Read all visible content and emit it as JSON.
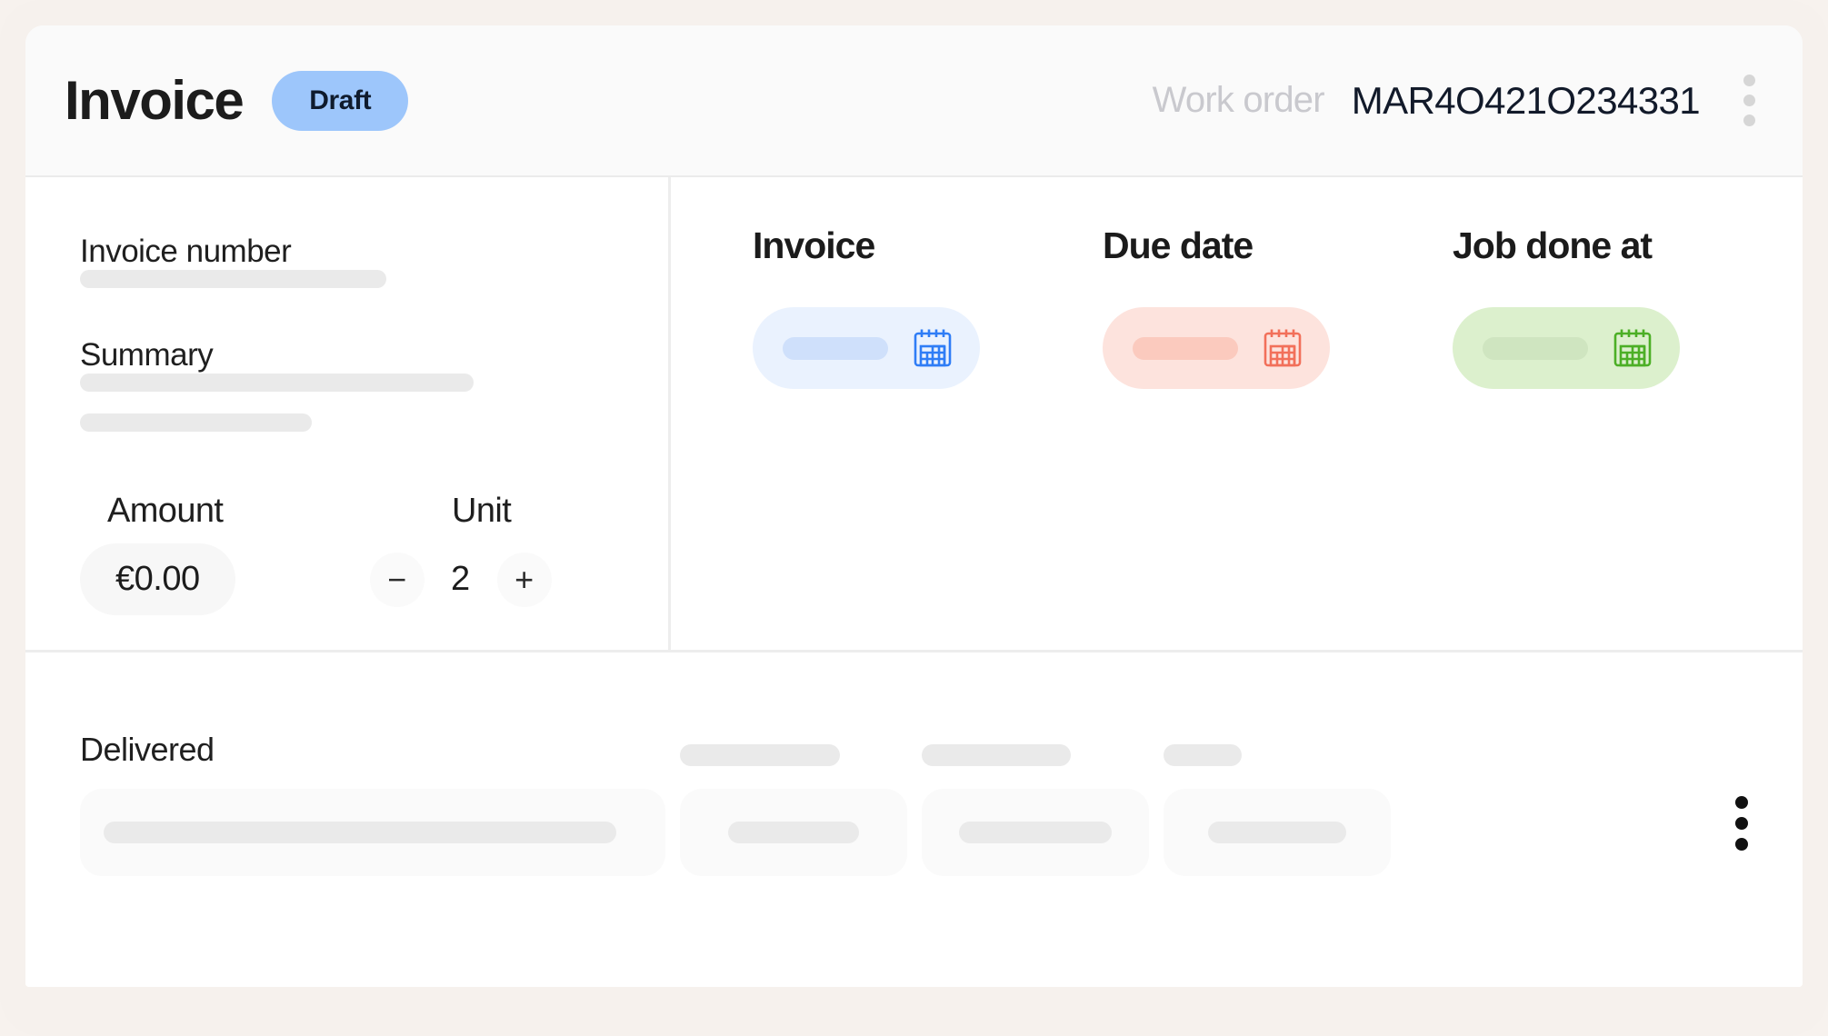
{
  "header": {
    "title": "Invoice",
    "status_badge": "Draft",
    "work_order_label": "Work order",
    "work_order_value": "MAR4O421O234331",
    "menu_icon": "kebab-menu-icon"
  },
  "left_panel": {
    "invoice_number_label": "Invoice number",
    "summary_label": "Summary",
    "amount_label": "Amount",
    "unit_label": "Unit",
    "amount_value": "€0.00",
    "unit_value": "2",
    "decrement_label": "−",
    "increment_label": "+"
  },
  "right_panel": {
    "columns": [
      {
        "label": "Invoice",
        "pill_color": "#eaf2fe",
        "icon": "calendar-icon"
      },
      {
        "label": "Due date",
        "pill_color": "#fde3dd",
        "icon": "calendar-icon"
      },
      {
        "label": "Job done at",
        "pill_color": "#dcf0cd",
        "icon": "calendar-icon"
      }
    ]
  },
  "bottom": {
    "delivered_label": "Delivered",
    "row_menu_icon": "kebab-menu-icon"
  },
  "colors": {
    "page_background": "#f6f1ed",
    "card_background": "#ffffff",
    "header_background": "#fafafa",
    "badge_background": "#9dc6fb",
    "skeleton": "#eaeaea",
    "invoice_accent": "#2f7df6",
    "due_date_accent": "#f2705a",
    "job_done_accent": "#4caf26"
  }
}
